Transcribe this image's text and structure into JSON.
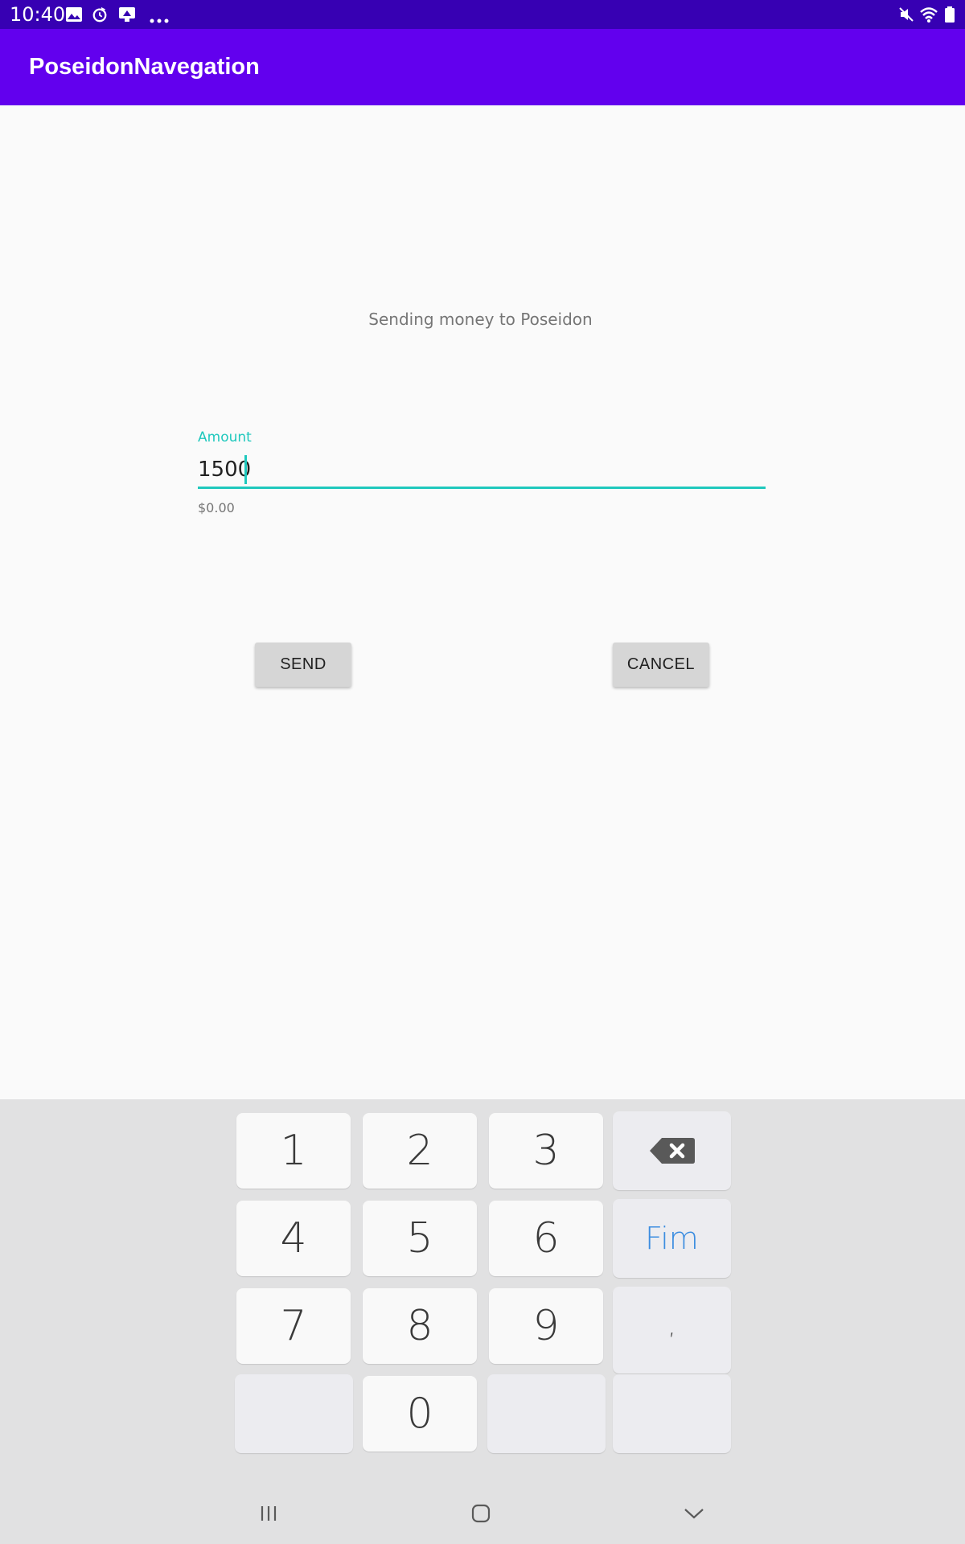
{
  "status_bar": {
    "time": "10:40",
    "left_icons": [
      "image-icon",
      "sync-icon",
      "screenshot-icon",
      "more-icon"
    ],
    "right_icons": [
      "mute-icon",
      "wifi-icon",
      "battery-icon"
    ]
  },
  "app_bar": {
    "title": "PoseidonNavegation",
    "color": "#6200ee"
  },
  "content": {
    "subtitle": "Sending money to Poseidon",
    "amount_label": "Amount",
    "amount_value": "1500",
    "helper_text": "$0.00",
    "accent_color": "#1fc8bd"
  },
  "buttons": {
    "send": "SEND",
    "cancel": "CANCEL"
  },
  "keyboard": {
    "rows": [
      [
        "1",
        "2",
        "3",
        "⌫"
      ],
      [
        "4",
        "5",
        "6",
        "Fim"
      ],
      [
        "7",
        "8",
        "9",
        ","
      ],
      [
        "",
        "0",
        "",
        ""
      ]
    ],
    "action_color": "#3c8de0"
  },
  "nav_bar": [
    "recent-apps-icon",
    "home-icon",
    "back-icon"
  ]
}
